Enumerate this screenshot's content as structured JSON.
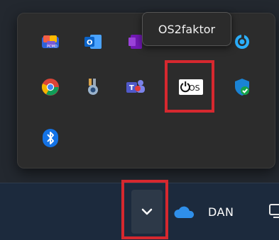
{
  "tooltip": {
    "text": "OS2faktor"
  },
  "tray": {
    "icons": [
      {
        "name": "copilot-icon"
      },
      {
        "name": "outlook-icon"
      },
      {
        "name": "onenote-icon"
      },
      {
        "name": "edge-sync-icon"
      },
      {
        "name": "chrome-icon"
      },
      {
        "name": "medal-icon"
      },
      {
        "name": "teams-icon"
      },
      {
        "name": "os2faktor-icon",
        "label": "OS"
      },
      {
        "name": "defender-icon"
      },
      {
        "name": "bluetooth-icon"
      }
    ]
  },
  "taskbar": {
    "chevron": "chevron-up-icon",
    "onedrive": "onedrive-icon",
    "language": "DAN"
  }
}
